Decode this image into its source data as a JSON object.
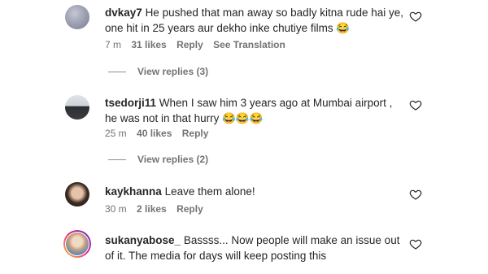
{
  "comments": [
    {
      "username": "dvkay7",
      "text_line1": "He pushed that man away so badly kitna rude hai ye,",
      "text_line2": "one hit in 25 years aur dekho inke chutiye films 😂",
      "time": "7 m",
      "likes": "31 likes",
      "reply": "Reply",
      "translate": "See Translation",
      "view_replies": "View replies (3)"
    },
    {
      "username": "tsedorji11",
      "text_line1": "When I saw him 3 years ago at Mumbai airport ,",
      "text_line2": "he was not in that hurry 😂😂😂",
      "time": "25 m",
      "likes": "40 likes",
      "reply": "Reply",
      "view_replies": "View replies (2)"
    },
    {
      "username": "kaykhanna",
      "text_line1": "Leave them alone!",
      "time": "30 m",
      "likes": "2 likes",
      "reply": "Reply"
    },
    {
      "username": "sukanyabose_",
      "text_line1": "Bassss... Now people will make an issue out",
      "text_line2": "of it. The media for days will keep posting this"
    }
  ],
  "icons": {
    "like": "heart-outline-icon"
  },
  "colors": {
    "text": "#262626",
    "meta": "#737373"
  }
}
